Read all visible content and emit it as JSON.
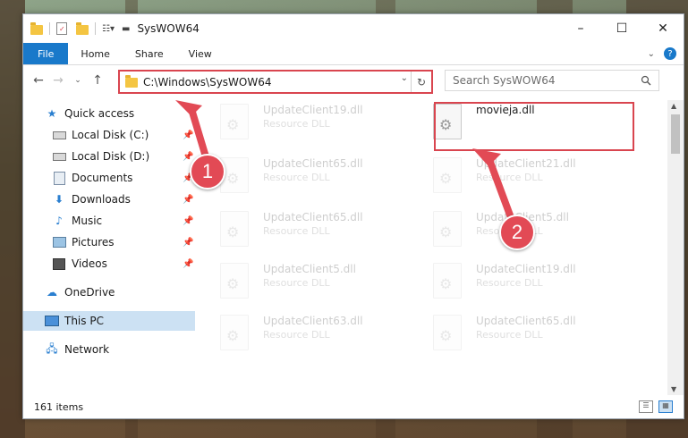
{
  "window": {
    "title": "SysWOW64"
  },
  "window_controls": {
    "minimize": "–",
    "maximize": "☐",
    "close": "✕"
  },
  "ribbon": {
    "tabs": [
      "File",
      "Home",
      "Share",
      "View"
    ],
    "help": "?"
  },
  "address": {
    "path": "C:\\Windows\\SysWOW64"
  },
  "search": {
    "placeholder": "Search SysWOW64",
    "icon": "search-icon"
  },
  "nav": {
    "items": [
      {
        "label": "Quick access",
        "icon": "star-icon",
        "pinned": false
      },
      {
        "label": "Local Disk (C:)",
        "icon": "drive-icon",
        "pinned": true
      },
      {
        "label": "Local Disk (D:)",
        "icon": "drive-icon",
        "pinned": true
      },
      {
        "label": "Documents",
        "icon": "documents-icon",
        "pinned": true
      },
      {
        "label": "Downloads",
        "icon": "download-icon",
        "pinned": true
      },
      {
        "label": "Music",
        "icon": "music-icon",
        "pinned": true
      },
      {
        "label": "Pictures",
        "icon": "pictures-icon",
        "pinned": true
      },
      {
        "label": "Videos",
        "icon": "videos-icon",
        "pinned": true
      },
      {
        "label": "OneDrive",
        "icon": "cloud-icon",
        "pinned": false
      },
      {
        "label": "This PC",
        "icon": "pc-icon",
        "pinned": false,
        "selected": true
      },
      {
        "label": "Network",
        "icon": "network-icon",
        "pinned": false
      }
    ]
  },
  "files": [
    {
      "name": "UpdateClient19.dll",
      "type": "Resource DLL",
      "faded": true
    },
    {
      "name": "movieja.dll",
      "type": "",
      "faded": false
    },
    {
      "name": "UpdateClient65.dll",
      "type": "Resource DLL",
      "faded": true
    },
    {
      "name": "UpdateClient21.dll",
      "type": "Resource DLL",
      "faded": true
    },
    {
      "name": "UpdateClient65.dll",
      "type": "Resource DLL",
      "faded": true
    },
    {
      "name": "UpdateClient5.dll",
      "type": "Resource DLL",
      "faded": true
    },
    {
      "name": "UpdateClient5.dll",
      "type": "Resource DLL",
      "faded": true
    },
    {
      "name": "UpdateClient19.dll",
      "type": "Resource DLL",
      "faded": true
    },
    {
      "name": "UpdateClient63.dll",
      "type": "Resource DLL",
      "faded": true
    },
    {
      "name": "UpdateClient65.dll",
      "type": "Resource DLL",
      "faded": true
    }
  ],
  "status": {
    "item_count": "161 items"
  },
  "callouts": {
    "one": "1",
    "two": "2"
  },
  "colors": {
    "accent": "#1979ca",
    "highlight": "#d9454f",
    "selection": "#cce1f3"
  }
}
